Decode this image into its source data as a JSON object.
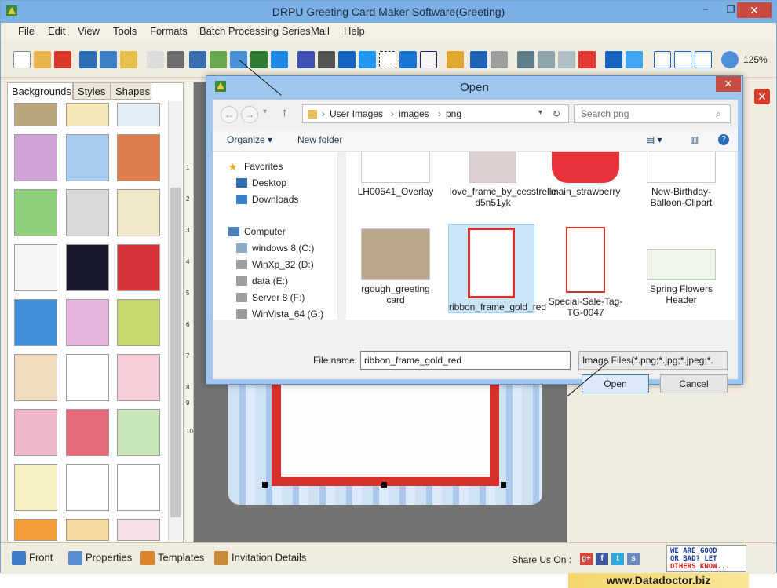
{
  "app": {
    "title": "DRPU Greeting Card Maker Software(Greeting)",
    "window_controls": {
      "minimize": "−",
      "maximize": "❐",
      "close": "✕"
    }
  },
  "menu": [
    "File",
    "Edit",
    "View",
    "Tools",
    "Formats",
    "Batch Processing Series",
    "Mail",
    "Help"
  ],
  "toolbar": {
    "zoom": "125%"
  },
  "left_panel": {
    "tabs": [
      "Backgrounds",
      "Styles",
      "Shapes"
    ],
    "active_tab": "Backgrounds"
  },
  "ruler": [
    "1",
    "2",
    "3",
    "4",
    "5",
    "6",
    "7",
    "8",
    "9",
    "10"
  ],
  "bottom": {
    "front": "Front",
    "properties": "Properties",
    "templates": "Templates",
    "invitation": "Invitation Details",
    "share": "Share Us On :",
    "feedback_line1": "WE ARE GOOD",
    "feedback_line2": "OR BAD? LET",
    "feedback_line3": "OTHERS KNOW..."
  },
  "banner": "www.Datadoctor.biz",
  "dialog": {
    "title": "Open",
    "close": "✕",
    "breadcrumb": [
      "User Images",
      "images",
      "png"
    ],
    "search_placeholder": "Search png",
    "organize": "Organize ▾",
    "new_folder": "New folder",
    "nav": {
      "favorites": "Favorites",
      "desktop": "Desktop",
      "downloads": "Downloads",
      "computer": "Computer",
      "drives": [
        "windows 8 (C:)",
        "WinXp_32 (D:)",
        "data  (E:)",
        "Server 8 (F:)",
        "WinVista_64 (G:)"
      ]
    },
    "files_row1": [
      "LH00541_Overlay",
      "love_frame_by_cesstrelle-d5n51yk",
      "main_strawberry",
      "New-Birthday-Balloon-Clipart"
    ],
    "files_row2": [
      "rgough_greeting card",
      "ribbon_frame_gold_red",
      "Special-Sale-Tag-TG-0047",
      "Spring Flowers Header"
    ],
    "selected_file": "ribbon_frame_gold_red",
    "file_name_label": "File name:",
    "file_name": "ribbon_frame_gold_red",
    "file_type": "Image Files(*.png;*.jpg;*.jpeg;*.",
    "open": "Open",
    "cancel": "Cancel"
  },
  "colors": {
    "title_bar": "#7ab0e6",
    "dialog_frame": "#9fc6ee",
    "canvas_bg": "#737373",
    "accent_red": "#d8312c"
  }
}
